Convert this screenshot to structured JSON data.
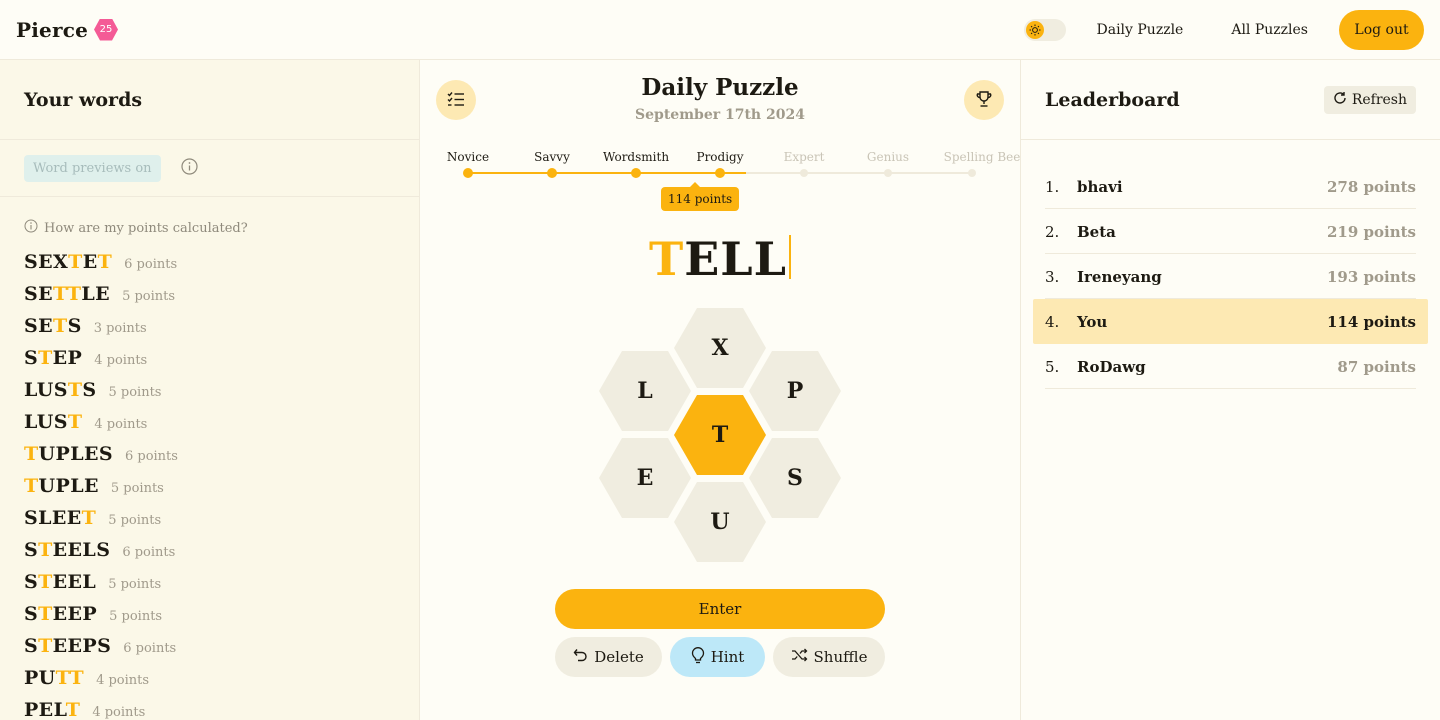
{
  "header": {
    "brand_name": "Pierce",
    "brand_badge": "25",
    "nav": {
      "daily_puzzle": "Daily Puzzle",
      "all_puzzles": "All Puzzles",
      "logout": "Log out"
    }
  },
  "left": {
    "title": "Your words",
    "preview_chip": "Word previews on",
    "points_help": "How are my points calculated?",
    "words": [
      {
        "parts": [
          "SEX",
          "T",
          "E",
          "T",
          ""
        ],
        "points": "6 points"
      },
      {
        "parts": [
          "SE",
          "TT",
          "LE",
          "",
          ""
        ],
        "points": "5 points"
      },
      {
        "parts": [
          "SE",
          "T",
          "S",
          "",
          ""
        ],
        "points": "3 points"
      },
      {
        "parts": [
          "S",
          "T",
          "EP",
          "",
          ""
        ],
        "points": "4 points"
      },
      {
        "parts": [
          "LUS",
          "T",
          "S",
          "",
          ""
        ],
        "points": "5 points"
      },
      {
        "parts": [
          "LUS",
          "T",
          "",
          "",
          ""
        ],
        "points": "4 points"
      },
      {
        "parts": [
          "",
          "T",
          "UPLES",
          "",
          ""
        ],
        "points": "6 points"
      },
      {
        "parts": [
          "",
          "T",
          "UPLE",
          "",
          ""
        ],
        "points": "5 points"
      },
      {
        "parts": [
          "SLEE",
          "T",
          "",
          "",
          ""
        ],
        "points": "5 points"
      },
      {
        "parts": [
          "S",
          "T",
          "EELS",
          "",
          ""
        ],
        "points": "6 points"
      },
      {
        "parts": [
          "S",
          "T",
          "EEL",
          "",
          ""
        ],
        "points": "5 points"
      },
      {
        "parts": [
          "S",
          "T",
          "EEP",
          "",
          ""
        ],
        "points": "5 points"
      },
      {
        "parts": [
          "S",
          "T",
          "EEPS",
          "",
          ""
        ],
        "points": "6 points"
      },
      {
        "parts": [
          "PU",
          "TT",
          "",
          "",
          ""
        ],
        "points": "4 points"
      },
      {
        "parts": [
          "PEL",
          "T",
          "",
          "",
          ""
        ],
        "points": "4 points"
      }
    ]
  },
  "center": {
    "title": "Daily Puzzle",
    "date": "September 17th 2024",
    "ranks": [
      "Novice",
      "Savvy",
      "Wordsmith",
      "Prodigy",
      "Expert",
      "Genius",
      "Spelling Bee"
    ],
    "ranks_reached": 4,
    "score": "114 points",
    "current_word_center_letter": "T",
    "current_word_rest": "ELL",
    "letters": {
      "top": "X",
      "upper_left": "L",
      "upper_right": "P",
      "center": "T",
      "lower_left": "E",
      "lower_right": "S",
      "bottom": "U"
    },
    "buttons": {
      "enter": "Enter",
      "delete": "Delete",
      "hint": "Hint",
      "shuffle": "Shuffle"
    }
  },
  "leaderboard": {
    "title": "Leaderboard",
    "refresh": "Refresh",
    "rows": [
      {
        "rank": "1.",
        "name": "bhavi",
        "points": "278 points",
        "me": false
      },
      {
        "rank": "2.",
        "name": "Beta",
        "points": "219 points",
        "me": false
      },
      {
        "rank": "3.",
        "name": "Ireneyang",
        "points": "193 points",
        "me": false
      },
      {
        "rank": "4.",
        "name": "You",
        "points": "114 points",
        "me": true
      },
      {
        "rank": "5.",
        "name": "RoDawg",
        "points": "87 points",
        "me": false
      }
    ]
  },
  "colors": {
    "accent": "#fbb30f",
    "accent_light": "#fde9b3",
    "hint": "#bde8f8",
    "badge": "#f45b96",
    "tile": "#f0ede0"
  }
}
